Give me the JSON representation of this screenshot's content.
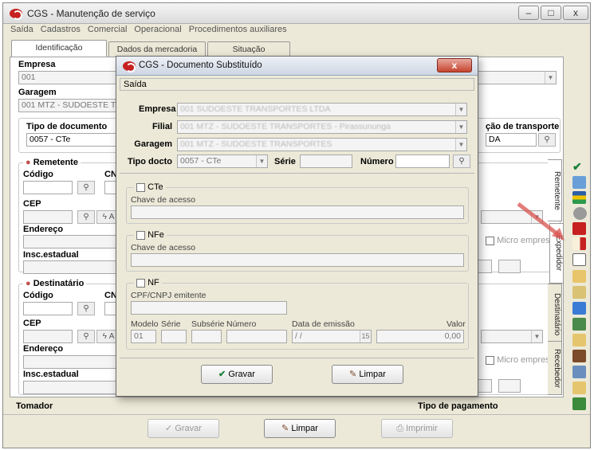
{
  "window": {
    "title": "CGS - Manutenção de serviço",
    "controls": {
      "minimize": "–",
      "maximize": "□",
      "close": "x"
    }
  },
  "menu": [
    "Saída",
    "Cadastros",
    "Comercial",
    "Operacional",
    "Procedimentos auxiliares"
  ],
  "tabs": [
    "Identificação",
    "Dados da mercadoria",
    "Situação"
  ],
  "form": {
    "empresa_label": "Empresa",
    "empresa_value": "001",
    "filial_label": "Filial",
    "garagem_label": "Garagem",
    "garagem_value": "001 MTZ - SUDOESTE TRANSPORTES",
    "tipo_documento_label": "Tipo de documento",
    "tipo_documento_value": "0057 - CTe",
    "situacao_transporte_label": "ção de transporte",
    "situacao_transporte_value": "DA",
    "remetente_title": "Remetente",
    "destinatario_title": "Destinatário",
    "codigo_label": "Código",
    "cn_label": "CN",
    "cep_label": "CEP",
    "endereco_label": "Endereço",
    "insc_label": "Insc.estadual",
    "micro_empresa_label": "Micro empresa",
    "tomador_label": "Tomador",
    "tipo_pagamento_label": "Tipo de pagamento"
  },
  "side_tabs": [
    "Remetente",
    "Expedidor",
    "Destinatário",
    "Recebedor"
  ],
  "bottom_buttons": {
    "gravar": "Gravar",
    "limpar": "Limpar",
    "imprimir": "Imprimir"
  },
  "dialog": {
    "title": "CGS - Documento Substituído",
    "close": "x",
    "menu": "Saída",
    "empresa_label": "Empresa",
    "filial_label": "Filial",
    "garagem_label": "Garagem",
    "tipo_docto_label": "Tipo docto",
    "tipo_docto_value": "0057 - CTe",
    "serie_label": "Série",
    "numero_label": "Número",
    "cte_label": "CTe",
    "nfe_label": "NFe",
    "nf_label": "NF",
    "chave_label": "Chave de acesso",
    "cpf_label": "CPF/CNPJ emitente",
    "modelo_label": "Modelo",
    "serie2_label": "Série",
    "subserie_label": "Subsérie",
    "numero2_label": "Número",
    "data_emissao_label": "Data de emissão",
    "valor_label": "Valor",
    "modelo_value": "01",
    "data_value": "/ /",
    "valor_value": "0,00",
    "gravar_label": "Gravar",
    "limpar_label": "Limpar"
  },
  "colors": {
    "accent_red": "#c62020",
    "arrow": "#d9534f"
  }
}
